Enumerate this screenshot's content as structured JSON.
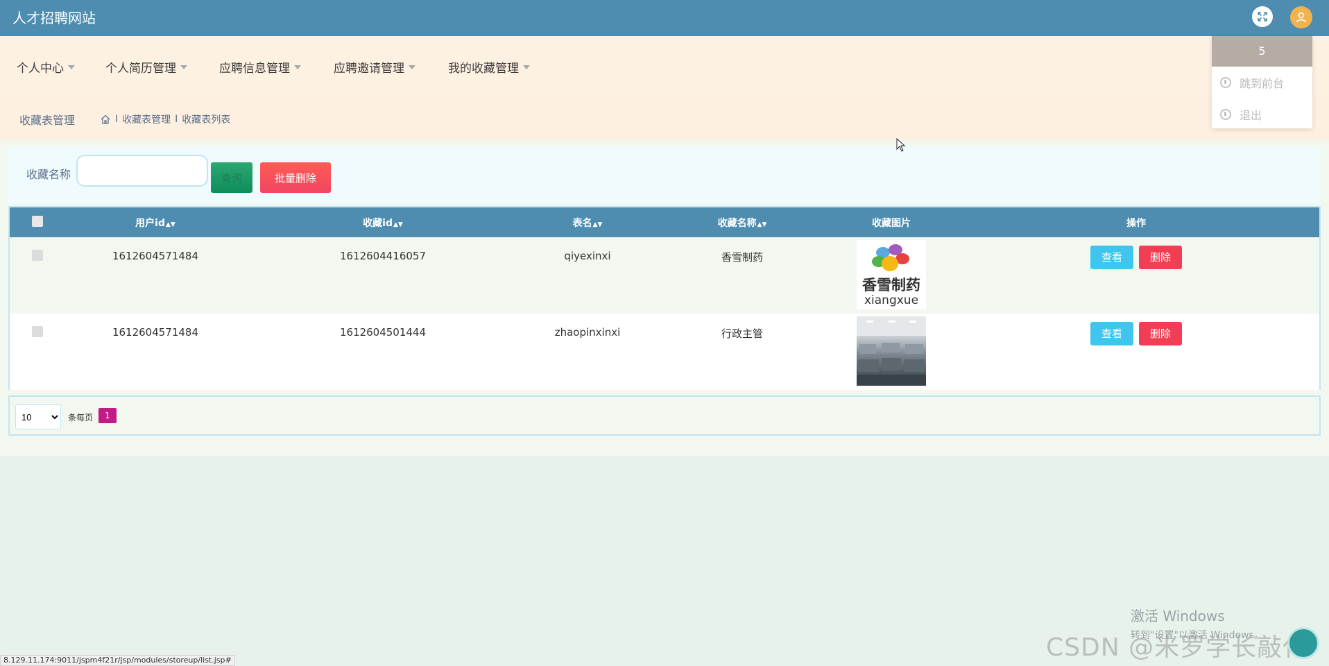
{
  "app": {
    "title": "人才招聘网站"
  },
  "user_menu": {
    "username": "5",
    "items": [
      {
        "label": "跳到前台"
      },
      {
        "label": "退出"
      }
    ]
  },
  "nav": {
    "items": [
      {
        "label": "个人中心"
      },
      {
        "label": "个人简历管理"
      },
      {
        "label": "应聘信息管理"
      },
      {
        "label": "应聘邀请管理"
      },
      {
        "label": "我的收藏管理"
      }
    ]
  },
  "breadcrumb": {
    "title": "收藏表管理",
    "path": [
      "收藏表管理",
      "收藏表列表"
    ]
  },
  "search": {
    "label": "收藏名称",
    "value": "",
    "query_button": "查询",
    "batch_delete_button": "批量删除"
  },
  "table": {
    "columns": [
      "用户id",
      "收藏id",
      "表名",
      "收藏名称",
      "收藏图片",
      "操作"
    ],
    "rows": [
      {
        "user_id": "1612604571484",
        "ref_id": "1612604416057",
        "table_name": "qiyexinxi",
        "name": "香雪制药",
        "image_text": "香雪制药",
        "image_subtext": "xiangxue"
      },
      {
        "user_id": "1612604571484",
        "ref_id": "1612604501444",
        "table_name": "zhaopinxinxi",
        "name": "行政主管",
        "image_text": "",
        "image_subtext": ""
      }
    ],
    "view_label": "查看",
    "delete_label": "删除"
  },
  "pagination": {
    "page_size": "10",
    "page_size_options": [
      "10"
    ],
    "per_page_label": "条每页",
    "current_page": "1"
  },
  "status_bar": {
    "url": "8.129.11.174:9011/jspm4f21r/jsp/modules/storeup/list.jsp#"
  },
  "os_overlay": {
    "activate_title": "激活 Windows",
    "activate_hint": "转到\"设置\"以激活 Windows。",
    "watermark": "CSDN @米罗学长敲代码"
  },
  "colors": {
    "topbar": "#4e8db0",
    "nav_bg": "#fdf1e2",
    "page_bg": "#e6f2ea",
    "query_green": "#0f8e5d",
    "delete_red": "#f23e55",
    "view_blue": "#40c6ee",
    "page_active": "#c31b86"
  },
  "icons": {
    "fullscreen": "expand-icon",
    "avatar": "user-icon",
    "home": "home-icon",
    "menu_item": "power-icon"
  }
}
